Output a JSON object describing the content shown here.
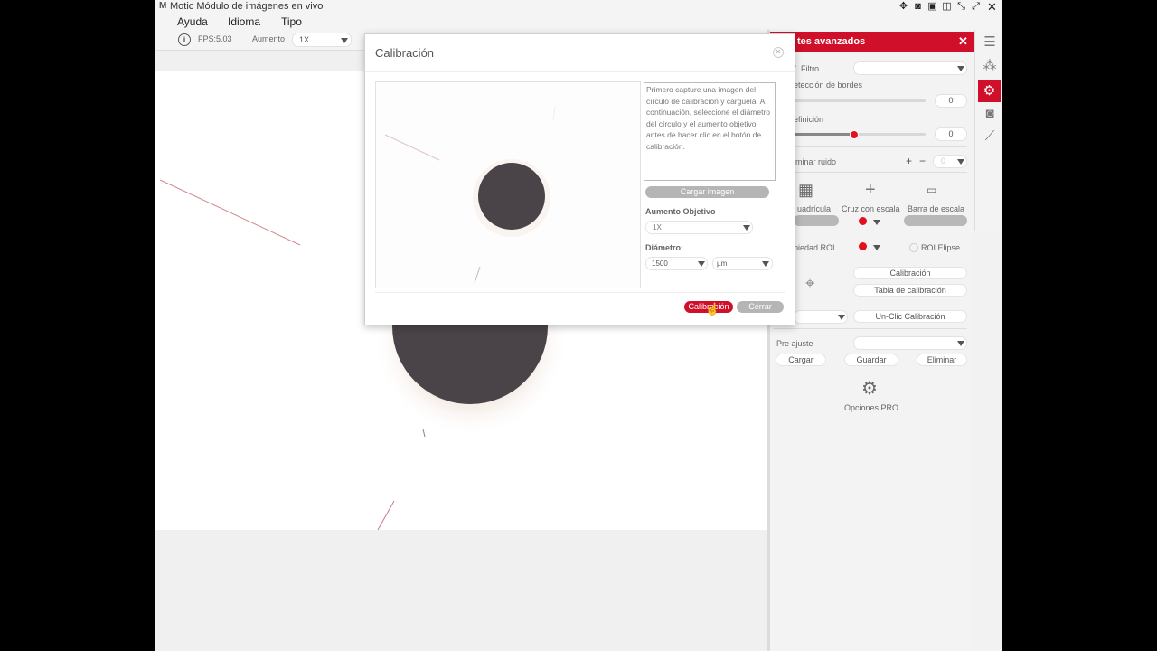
{
  "window": {
    "title": "Motic Módulo de imágenes en vivo",
    "logo": "M"
  },
  "menu": [
    "Ayuda",
    "Idioma",
    "Tipo"
  ],
  "toolbar": {
    "fps": "FPS:5.03",
    "aumento_label": "Aumento",
    "aumento_value": "1X"
  },
  "panel": {
    "header": "tes avanzados",
    "filtro_label": "Filtro",
    "bordes_label": "etección de bordes",
    "bordes_value": "0",
    "definicion_label": "efinición",
    "definicion_value": "0",
    "definicion_level": 0.45,
    "ruido_label": "iminar ruido",
    "ruido_value": "0",
    "grid_labels": [
      "uadrícula",
      "Cruz con escala",
      "Barra de escala"
    ],
    "roi_label": "piedad ROI",
    "roi_ellipse": "ROI Elipse",
    "calibracion_btn": "Calibración",
    "tabla_btn": "Tabla de calibración",
    "unclic_btn": "Un-Clic Calibración",
    "preajuste_label": "Pre ajuste",
    "cargar": "Cargar",
    "guardar": "Guardar",
    "eliminar": "Eliminar",
    "opciones_pro": "Opciones PRO"
  },
  "dialog": {
    "title": "Calibración",
    "instructions": "Primero capture una imagen del círculo de calibración y cárguela. A continuación, seleccione el diámetro del círculo y el aumento objetivo antes de hacer clic en el botón de calibración.",
    "cargar_imagen": "Cargar imagen",
    "aumento_objetivo_label": "Aumento Objetivo",
    "aumento_objetivo_value": "1X",
    "diametro_label": "Diámetro:",
    "diametro_value": "1500",
    "unit_value": "µm",
    "calibracion_button": "Calibración",
    "cerrar_button": "Cerrar"
  },
  "colors": {
    "accent": "#d0102a",
    "dark_disc": "#4a4448"
  },
  "icons": [
    "info-icon",
    "move-icon",
    "camera-icon",
    "restore-icon",
    "layout-icon",
    "expand-icon",
    "fullscreen-icon",
    "close-icon",
    "sliders-icon",
    "color-channels-icon",
    "gear-icon",
    "camera-icon",
    "ruler-icon",
    "grid-icon",
    "crosshair-icon",
    "scale-bar-icon",
    "target-icon"
  ]
}
